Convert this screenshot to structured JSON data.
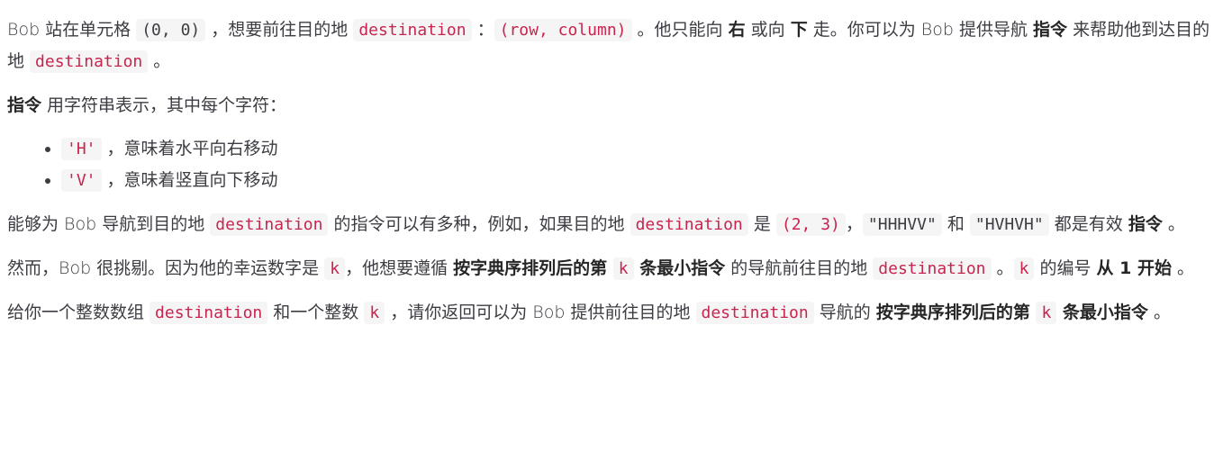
{
  "p1": {
    "t1": "Bob 站在单元格 ",
    "c1": "(0, 0)",
    "t2": " ，想要前往目的地 ",
    "c2": "destination",
    "t3": " ：",
    "c3": "(row, column)",
    "t4": " 。他只能向 ",
    "b1": "右",
    "t5": " 或向 ",
    "b2": "下",
    "t6": " 走。你可以为 Bob 提供导航 ",
    "b3": "指令",
    "t7": " 来帮助他到达目的地 ",
    "c4": "destination",
    "t8": " 。"
  },
  "p2": {
    "b1": "指令",
    "t1": " 用字符串表示，其中每个字符："
  },
  "list": [
    {
      "code": "'H'",
      "text": " ，意味着水平向右移动"
    },
    {
      "code": "'V'",
      "text": " ，意味着竖直向下移动"
    }
  ],
  "p3": {
    "t1": "能够为 Bob 导航到目的地 ",
    "c1": "destination",
    "t2": " 的指令可以有多种，例如，如果目的地 ",
    "c2": "destination",
    "t3": " 是 ",
    "c3": "(2, 3)",
    "t4": "，",
    "c4": "\"HHHVV\"",
    "t5": " 和 ",
    "c5": "\"HVHVH\"",
    "t6": " 都是有效 ",
    "b1": "指令",
    "t7": " 。"
  },
  "p4": {
    "t1": "然而，Bob 很挑剔。因为他的幸运数字是 ",
    "c1": "k",
    "t2": "，他想要遵循 ",
    "b1": "按字典序排列后的第 ",
    "c2": "k",
    "b2": " 条最小指令",
    "t3": " 的导航前往目的地 ",
    "c3": "destination",
    "t4": " 。",
    "c4": "k",
    "t5": "  的编号 ",
    "b3": "从 1 开始",
    "t6": " 。"
  },
  "p5": {
    "t1": "给你一个整数数组 ",
    "c1": "destination",
    "t2": " 和一个整数 ",
    "c2": "k",
    "t3": " ，请你返回可以为 Bob 提供前往目的地 ",
    "c3": "destination",
    "t4": " 导航的 ",
    "b1": "按字典序排列后的第 ",
    "c4": "k",
    "b2": " 条最小指令",
    "t5": " 。"
  }
}
